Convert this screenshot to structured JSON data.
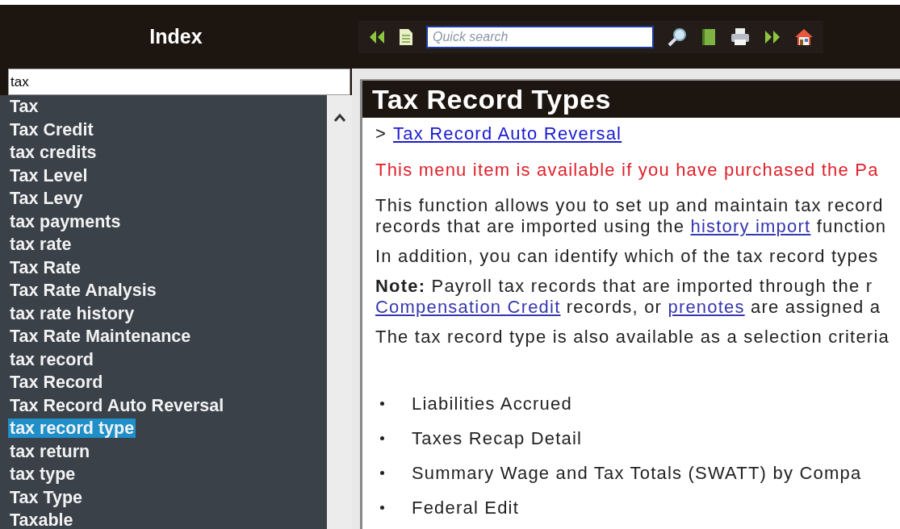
{
  "index_panel": {
    "title": "Index",
    "search": {
      "value": "tax"
    },
    "items": [
      {
        "label": "Tax",
        "selected": false
      },
      {
        "label": "Tax Credit",
        "selected": false
      },
      {
        "label": "tax credits",
        "selected": false
      },
      {
        "label": "Tax Level",
        "selected": false
      },
      {
        "label": "Tax Levy",
        "selected": false
      },
      {
        "label": "tax payments",
        "selected": false
      },
      {
        "label": "tax rate",
        "selected": false
      },
      {
        "label": "Tax Rate",
        "selected": false
      },
      {
        "label": "Tax Rate Analysis",
        "selected": false
      },
      {
        "label": "tax rate history",
        "selected": false
      },
      {
        "label": "Tax Rate Maintenance",
        "selected": false
      },
      {
        "label": "tax record",
        "selected": false
      },
      {
        "label": "Tax Record",
        "selected": false
      },
      {
        "label": "Tax Record Auto Reversal",
        "selected": false
      },
      {
        "label": "tax record type",
        "selected": true
      },
      {
        "label": "tax return",
        "selected": false
      },
      {
        "label": "tax type",
        "selected": false
      },
      {
        "label": "Tax Type",
        "selected": false
      },
      {
        "label": "Taxable",
        "selected": false
      }
    ]
  },
  "toolbar": {
    "search": {
      "placeholder": "Quick search"
    }
  },
  "topic": {
    "title": "Tax Record Types",
    "breadcrumb": {
      "marker": ">",
      "link": "Tax Record Auto Reversal"
    },
    "notice": "This menu item is available if you have purchased the Pa",
    "paragraphs": [
      {
        "lines": [
          [
            {
              "text": "This function allows you to set up and maintain tax record",
              "link": false
            }
          ],
          [
            {
              "text": "records that are imported using the ",
              "link": false
            },
            {
              "text": "history import",
              "link": true
            },
            {
              "text": " function",
              "link": false
            }
          ]
        ]
      },
      {
        "lines": [
          [
            {
              "text": "In addition, you can identify which of the tax record types",
              "link": false
            }
          ]
        ]
      },
      {
        "lines": [
          [
            {
              "text": "**Note:**  Payroll tax records that are imported through the r",
              "link": false
            }
          ],
          [
            {
              "text": "Compensation Credit",
              "link": true
            },
            {
              "text": " records, or ",
              "link": false
            },
            {
              "text": "prenotes",
              "link": true
            },
            {
              "text": " are assigned a",
              "link": false
            }
          ]
        ]
      },
      {
        "lines": [
          [
            {
              "text": "The tax record type is also available as a selection criteria",
              "link": false
            }
          ]
        ]
      }
    ],
    "bullets": [
      "Liabilities Accrued",
      "Taxes Recap Detail",
      "Summary Wage and Tax Totals (SWATT) by Compa",
      "Federal Edit"
    ]
  }
}
